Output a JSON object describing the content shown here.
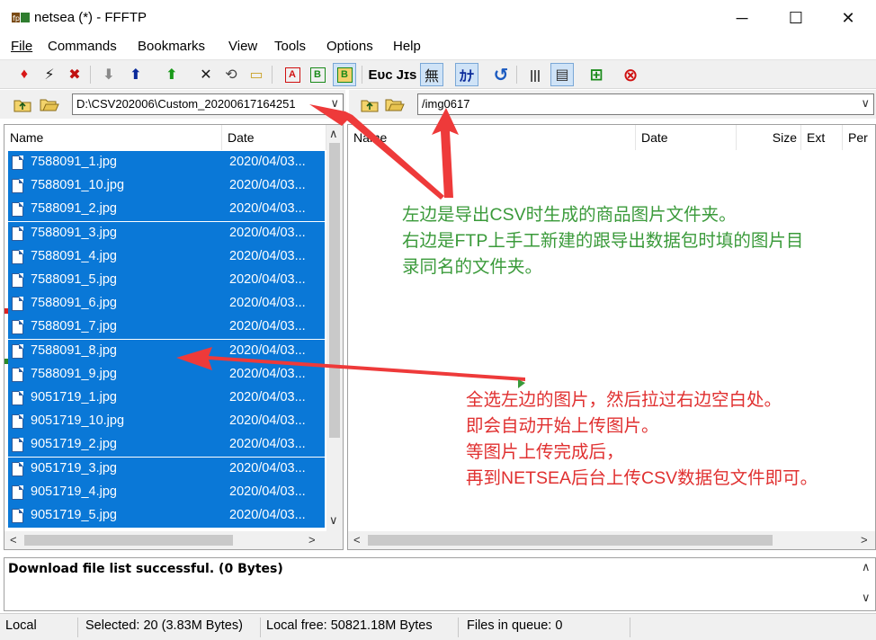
{
  "window": {
    "title": "netsea (*) - FFFTP",
    "minimize": "─",
    "maximize": "☐",
    "close": "✕"
  },
  "menu": [
    {
      "label": "File",
      "name": "menu-file"
    },
    {
      "label": "Commands",
      "name": "menu-commands"
    },
    {
      "label": "Bookmarks",
      "name": "menu-bookmarks"
    },
    {
      "label": "View",
      "name": "menu-view"
    },
    {
      "label": "Tools",
      "name": "menu-tools"
    },
    {
      "label": "Options",
      "name": "menu-options"
    },
    {
      "label": "Help",
      "name": "menu-help"
    }
  ],
  "toolbar": {
    "connect": "♦",
    "quick_connect": "⚡",
    "disconnect": "✖",
    "download": "⬇",
    "upload": "⬆",
    "mirror_upload": "⬆",
    "delete": "✕",
    "rename": "⟲",
    "mkdir": "▭",
    "mode_ascii": "A",
    "mode_binary": "B",
    "mode_auto": "B",
    "euc": "Eᴜᴄ",
    "jis": "Jɪs",
    "no_convert": "無",
    "kana": "ｶﾅ",
    "refresh": "↺",
    "list": "|||",
    "detail": "▤",
    "tree": "⊞",
    "stop": "⊗"
  },
  "left_path": {
    "value": "D:\\CSV202006\\Custom_20200617164251",
    "dropdown": "∨"
  },
  "right_path": {
    "value": "/img0617",
    "dropdown": "∨"
  },
  "left_pane": {
    "columns": {
      "name": "Name",
      "date": "Date"
    },
    "files": [
      {
        "name": "7588091_1.jpg",
        "date": "2020/04/03..."
      },
      {
        "name": "7588091_10.jpg",
        "date": "2020/04/03..."
      },
      {
        "name": "7588091_2.jpg",
        "date": "2020/04/03..."
      },
      {
        "name": "7588091_3.jpg",
        "date": "2020/04/03..."
      },
      {
        "name": "7588091_4.jpg",
        "date": "2020/04/03..."
      },
      {
        "name": "7588091_5.jpg",
        "date": "2020/04/03..."
      },
      {
        "name": "7588091_6.jpg",
        "date": "2020/04/03..."
      },
      {
        "name": "7588091_7.jpg",
        "date": "2020/04/03..."
      },
      {
        "name": "7588091_8.jpg",
        "date": "2020/04/03..."
      },
      {
        "name": "7588091_9.jpg",
        "date": "2020/04/03..."
      },
      {
        "name": "9051719_1.jpg",
        "date": "2020/04/03..."
      },
      {
        "name": "9051719_10.jpg",
        "date": "2020/04/03..."
      },
      {
        "name": "9051719_2.jpg",
        "date": "2020/04/03..."
      },
      {
        "name": "9051719_3.jpg",
        "date": "2020/04/03..."
      },
      {
        "name": "9051719_4.jpg",
        "date": "2020/04/03..."
      },
      {
        "name": "9051719_5.jpg",
        "date": "2020/04/03..."
      }
    ]
  },
  "right_pane": {
    "columns": {
      "name": "Name",
      "date": "Date",
      "size": "Size",
      "ext": "Ext",
      "perm": "Per"
    }
  },
  "scroll": {
    "up": "∧",
    "down": "∨",
    "left": "<",
    "right": ">"
  },
  "log": {
    "text": "Download file list successful. (0 Bytes)"
  },
  "status": {
    "side": "Local",
    "selected": "Selected: 20 (3.83M Bytes)",
    "free": "Local free: 50821.18M Bytes",
    "queue": "Files in queue: 0"
  },
  "annotations": {
    "green": [
      "左边是导出CSV时生成的商品图片文件夹。",
      "右边是FTP上手工新建的跟导出数据包时填的图片目",
      "录同名的文件夹。"
    ],
    "red": [
      "全选左边的图片，然后拉过右边空白处。",
      "即会自动开始上传图片。",
      "等图片上传完成后，",
      "再到NETSEA后台上传CSV数据包文件即可。"
    ],
    "green_color": "#3a9a3a",
    "red_color": "#e03030",
    "selection_color": "#0a78d7"
  }
}
